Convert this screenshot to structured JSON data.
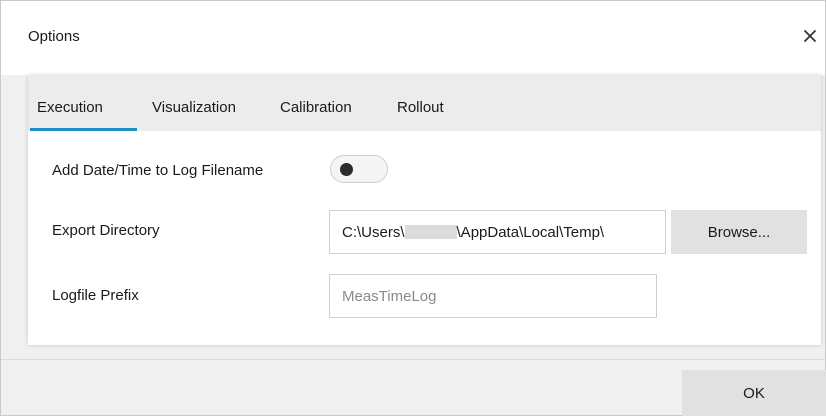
{
  "dialog": {
    "title": "Options",
    "close_glyph": "✕"
  },
  "tabs": [
    {
      "label": "Execution",
      "active": true
    },
    {
      "label": "Visualization",
      "active": false
    },
    {
      "label": "Calibration",
      "active": false
    },
    {
      "label": "Rollout",
      "active": false
    }
  ],
  "execution": {
    "add_datetime": {
      "label": "Add Date/Time to Log Filename",
      "enabled": false
    },
    "export_directory": {
      "label": "Export Directory",
      "value_prefix": "C:\\Users\\",
      "value_suffix": "\\AppData\\Local\\Temp\\",
      "browse_label": "Browse..."
    },
    "logfile_prefix": {
      "label": "Logfile Prefix",
      "placeholder": "MeasTimeLog"
    }
  },
  "footer": {
    "ok_label": "OK"
  },
  "colors": {
    "accent": "#1a8fc0",
    "button_bg": "#e1e1e1",
    "dialog_bg": "#f0f0f0"
  },
  "icons": {
    "close": "close-icon"
  }
}
